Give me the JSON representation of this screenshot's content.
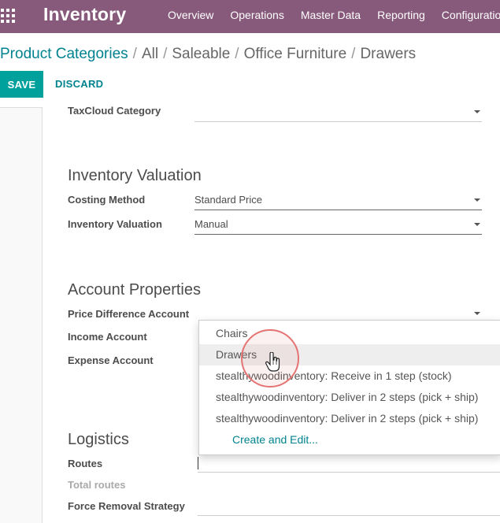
{
  "navbar": {
    "app_title": "Inventory",
    "menu": [
      "Overview",
      "Operations",
      "Master Data",
      "Reporting",
      "Configuration"
    ]
  },
  "breadcrumb": {
    "root": "Product Categories",
    "path": [
      "All",
      "Saleable",
      "Office Furniture",
      "Drawers"
    ]
  },
  "buttons": {
    "save": "SAVE",
    "discard": "DISCARD"
  },
  "form": {
    "taxcloud_label": "TaxCloud Category",
    "taxcloud_value": "",
    "inventory_valuation_section": "Inventory Valuation",
    "costing_method_label": "Costing Method",
    "costing_method_value": "Standard Price",
    "inventory_valuation_label": "Inventory Valuation",
    "inventory_valuation_value": "Manual",
    "account_properties_section": "Account Properties",
    "price_difference_label": "Price Difference Account",
    "income_account_label": "Income Account",
    "expense_account_label": "Expense Account",
    "logistics_section": "Logistics",
    "routes_label": "Routes",
    "total_routes_label": "Total routes",
    "force_removal_label": "Force Removal Strategy"
  },
  "dropdown": {
    "items": [
      "Chairs",
      "Drawers",
      "stealthywoodinventory: Receive in 1 step (stock)",
      "stealthywoodinventory: Deliver in 2 steps (pick + ship)",
      "stealthywoodinventory: Deliver in 2 steps (pick + ship)"
    ],
    "active_item": "Drawers",
    "create_label": "Create and Edit..."
  },
  "colors": {
    "navbar": "#875a7b",
    "accent": "#00a09d",
    "link": "#00838f",
    "click_ring": "#e57373"
  }
}
